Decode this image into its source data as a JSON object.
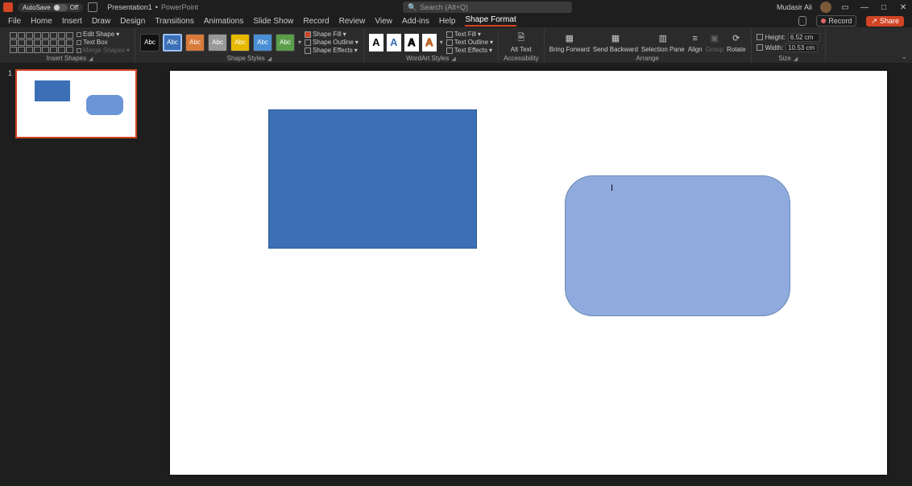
{
  "title": {
    "autosave_label": "AutoSave",
    "autosave_state": "Off",
    "doc_name": "Presentation1",
    "app_name": "PowerPoint",
    "search_placeholder": "Search (Alt+Q)",
    "user": "Mudasir Ali"
  },
  "menu": {
    "file": "File",
    "home": "Home",
    "insert": "Insert",
    "draw": "Draw",
    "design": "Design",
    "transitions": "Transitions",
    "animations": "Animations",
    "slideshow": "Slide Show",
    "record": "Record",
    "review": "Review",
    "view": "View",
    "addins": "Add-ins",
    "help": "Help",
    "shape_format": "Shape Format",
    "record_btn": "Record",
    "share_btn": "Share"
  },
  "ribbon": {
    "insert_shapes": {
      "label": "Insert Shapes",
      "edit_shape": "Edit Shape",
      "text_box": "Text Box",
      "merge": "Merge Shapes"
    },
    "shape_styles": {
      "label": "Shape Styles",
      "swatch_text": "Abc",
      "fill": "Shape Fill",
      "outline": "Shape Outline",
      "effects": "Shape Effects"
    },
    "wordart": {
      "label": "WordArt Styles",
      "letter": "A",
      "tfill": "Text Fill",
      "toutline": "Text Outline",
      "teffects": "Text Effects"
    },
    "access": {
      "label": "Accessibility",
      "alt": "Alt Text"
    },
    "arrange": {
      "label": "Arrange",
      "forward": "Bring Forward",
      "backward": "Send Backward",
      "selpane": "Selection Pane",
      "align": "Align",
      "group": "Group",
      "rotate": "Rotate"
    },
    "size": {
      "label": "Size",
      "height_label": "Height:",
      "height_val": "6.52 cm",
      "width_label": "Width:",
      "width_val": "10.53 cm"
    }
  },
  "thumb": {
    "num": "1"
  }
}
